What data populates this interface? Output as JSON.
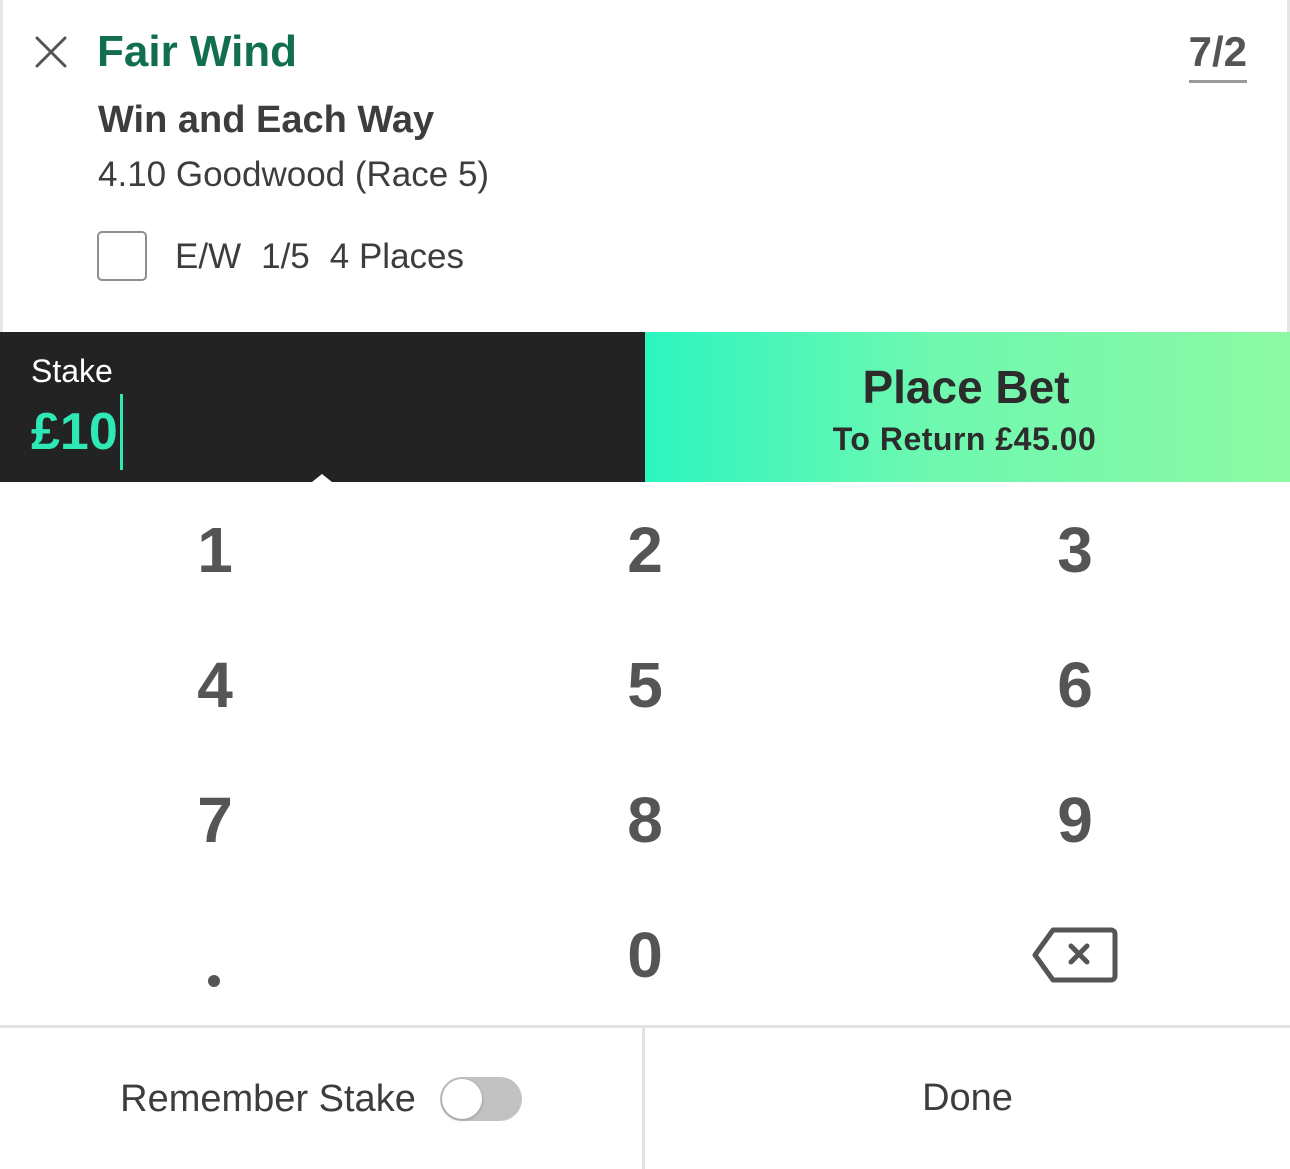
{
  "slip": {
    "selection_name": "Fair Wind",
    "odds": "7/2",
    "market_name": "Win and Each Way",
    "event_name": "4.10 Goodwood (Race 5)",
    "each_way": {
      "checked": false,
      "label_ew": "E/W",
      "label_terms": "1/5",
      "label_places": "4 Places"
    },
    "close_icon": "close-icon"
  },
  "stake": {
    "label": "Stake",
    "value": "£10"
  },
  "place_bet": {
    "label": "Place Bet",
    "return_text": "To Return £45.00"
  },
  "keypad": {
    "keys": [
      "1",
      "2",
      "3",
      "4",
      "5",
      "6",
      "7",
      "8",
      "9",
      ".",
      "0",
      "backspace"
    ],
    "backspace_icon": "backspace-icon"
  },
  "footer": {
    "remember_label": "Remember Stake",
    "remember_on": false,
    "done_label": "Done"
  },
  "colors": {
    "selection_green": "#126e51",
    "stake_bg": "#232323",
    "stake_accent": "#2ee8b5",
    "place_bet_gradient_start": "#2cf5c0",
    "place_bet_gradient_end": "#8cf9a3",
    "key_text": "#555555"
  }
}
